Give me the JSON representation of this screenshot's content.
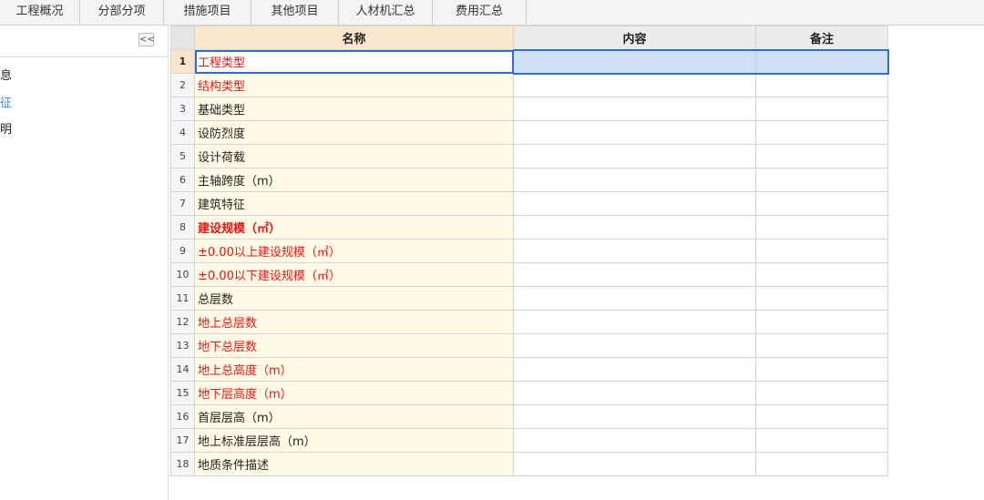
{
  "tabs": [
    {
      "label": "工程概况",
      "active": true
    },
    {
      "label": "分部分项",
      "active": false
    },
    {
      "label": "措施项目",
      "active": false
    },
    {
      "label": "其他项目",
      "active": false
    },
    {
      "label": "人材机汇总",
      "active": false
    },
    {
      "label": "费用汇总",
      "active": false
    }
  ],
  "left_panel": {
    "collapse_label": "<<",
    "items": [
      {
        "label": "息",
        "selected": false
      },
      {
        "label": "征",
        "selected": true
      },
      {
        "label": "明",
        "selected": false
      }
    ]
  },
  "grid": {
    "headers": {
      "rownum": "",
      "name": "名称",
      "content": "内容",
      "remark": "备注"
    },
    "rows": [
      {
        "num": "1",
        "name": "工程类型",
        "content": "",
        "remark": "",
        "red": true,
        "bold": false,
        "selected": true
      },
      {
        "num": "2",
        "name": "结构类型",
        "content": "",
        "remark": "",
        "red": true,
        "bold": false,
        "selected": false
      },
      {
        "num": "3",
        "name": "基础类型",
        "content": "",
        "remark": "",
        "red": false,
        "bold": false,
        "selected": false
      },
      {
        "num": "4",
        "name": "设防烈度",
        "content": "",
        "remark": "",
        "red": false,
        "bold": false,
        "selected": false
      },
      {
        "num": "5",
        "name": "设计荷载",
        "content": "",
        "remark": "",
        "red": false,
        "bold": false,
        "selected": false
      },
      {
        "num": "6",
        "name": "主轴跨度（m）",
        "content": "",
        "remark": "",
        "red": false,
        "bold": false,
        "selected": false
      },
      {
        "num": "7",
        "name": "建筑特征",
        "content": "",
        "remark": "",
        "red": false,
        "bold": false,
        "selected": false
      },
      {
        "num": "8",
        "name": "建设规模（㎡）",
        "content": "",
        "remark": "",
        "red": true,
        "bold": true,
        "selected": false
      },
      {
        "num": "9",
        "name": "±0.00以上建设规模（㎡）",
        "content": "",
        "remark": "",
        "red": true,
        "bold": false,
        "selected": false
      },
      {
        "num": "10",
        "name": "±0.00以下建设规模（㎡）",
        "content": "",
        "remark": "",
        "red": true,
        "bold": false,
        "selected": false
      },
      {
        "num": "11",
        "name": "总层数",
        "content": "",
        "remark": "",
        "red": false,
        "bold": false,
        "selected": false
      },
      {
        "num": "12",
        "name": "地上总层数",
        "content": "",
        "remark": "",
        "red": true,
        "bold": false,
        "selected": false
      },
      {
        "num": "13",
        "name": "地下总层数",
        "content": "",
        "remark": "",
        "red": true,
        "bold": false,
        "selected": false
      },
      {
        "num": "14",
        "name": "地上总高度（m）",
        "content": "",
        "remark": "",
        "red": true,
        "bold": false,
        "selected": false
      },
      {
        "num": "15",
        "name": "地下层高度（m）",
        "content": "",
        "remark": "",
        "red": true,
        "bold": false,
        "selected": false
      },
      {
        "num": "16",
        "name": "首层层高（m）",
        "content": "",
        "remark": "",
        "red": false,
        "bold": false,
        "selected": false
      },
      {
        "num": "17",
        "name": "地上标准层层高（m）",
        "content": "",
        "remark": "",
        "red": false,
        "bold": false,
        "selected": false
      },
      {
        "num": "18",
        "name": "地质条件描述",
        "content": "",
        "remark": "",
        "red": false,
        "bold": false,
        "selected": false
      }
    ]
  },
  "colors": {
    "accent": "#3a86d4",
    "required_text": "#e01818",
    "name_column_bg": "#fffbe6",
    "selection_fill": "#cfe0f5",
    "selection_border": "#2b6fd0"
  }
}
